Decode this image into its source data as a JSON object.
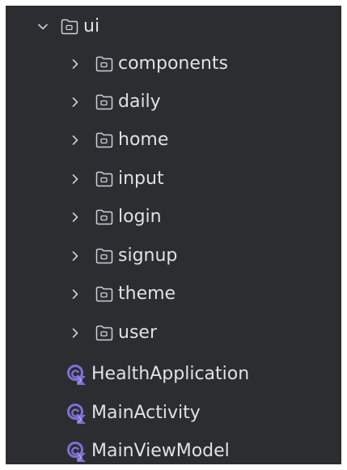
{
  "tree": {
    "root": {
      "label": "ui",
      "expanded": true,
      "icon": "folder-icon"
    },
    "folders": [
      {
        "label": "components",
        "expanded": false,
        "icon": "folder-icon"
      },
      {
        "label": "daily",
        "expanded": false,
        "icon": "folder-icon"
      },
      {
        "label": "home",
        "expanded": false,
        "icon": "folder-icon"
      },
      {
        "label": "input",
        "expanded": false,
        "icon": "folder-icon"
      },
      {
        "label": "login",
        "expanded": false,
        "icon": "folder-icon"
      },
      {
        "label": "signup",
        "expanded": false,
        "icon": "folder-icon"
      },
      {
        "label": "theme",
        "expanded": false,
        "icon": "folder-icon"
      },
      {
        "label": "user",
        "expanded": false,
        "icon": "folder-icon"
      }
    ],
    "files": [
      {
        "label": "HealthApplication",
        "icon": "kotlin-class-icon"
      },
      {
        "label": "MainActivity",
        "icon": "kotlin-class-icon"
      },
      {
        "label": "MainViewModel",
        "icon": "kotlin-class-icon"
      }
    ]
  },
  "colors": {
    "panel_bg": "#2b2d30",
    "text": "#dfe1e5",
    "chevron": "#ced0d6",
    "folder_outline": "#ced0d6",
    "class_icon_primary": "#7f6fd6",
    "class_icon_secondary": "#b59ff5"
  }
}
